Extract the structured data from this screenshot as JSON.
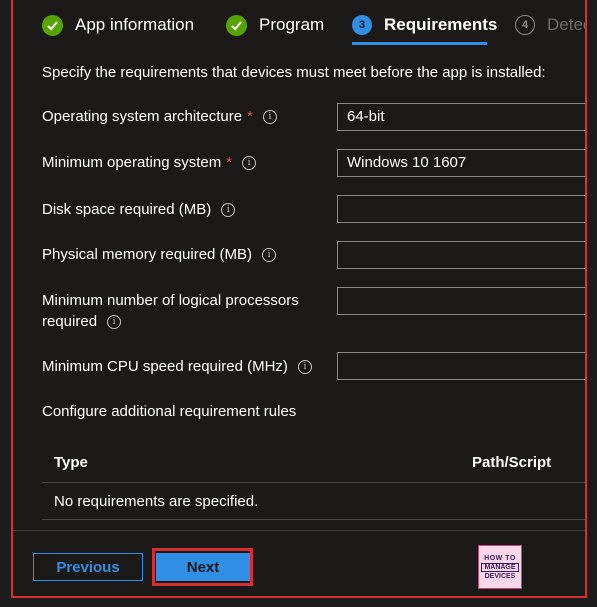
{
  "wizard": {
    "steps": [
      {
        "label": "App information",
        "state": "done"
      },
      {
        "label": "Program",
        "state": "done"
      },
      {
        "label": "Requirements",
        "state": "current",
        "number": "3"
      },
      {
        "label": "Detec",
        "state": "future",
        "number": "4"
      }
    ]
  },
  "intro": "Specify the requirements that devices must meet before the app is installed:",
  "fields": {
    "os_arch": {
      "label": "Operating system architecture",
      "required_mark": "*",
      "value": "64-bit"
    },
    "min_os": {
      "label": "Minimum operating system",
      "required_mark": "*",
      "value": "Windows 10 1607"
    },
    "disk_space": {
      "label": "Disk space required (MB)",
      "value": ""
    },
    "physical_memory": {
      "label": "Physical memory required (MB)",
      "value": ""
    },
    "logical_processors": {
      "label_line1": "Minimum number of logical processors",
      "label_line2": "required",
      "value": ""
    },
    "cpu_speed": {
      "label": "Minimum CPU speed required (MHz)",
      "value": ""
    }
  },
  "additional_rules": {
    "heading": "Configure additional requirement rules",
    "columns": [
      "Type",
      "Path/Script"
    ],
    "empty_message": "No requirements are specified."
  },
  "info_glyph": "i",
  "footer": {
    "previous_label": "Previous",
    "next_label": "Next"
  },
  "logo": {
    "line1": "HOW TO",
    "line2": "MANAGE",
    "line3": "DEVICES"
  },
  "colors": {
    "accent": "#2f8ee5",
    "success": "#57a300",
    "required": "#e04b4b",
    "highlight_border": "#d72f2f",
    "background": "#1b1a19"
  },
  "icons": {
    "done": "check-circle-icon",
    "info": "info-icon"
  }
}
